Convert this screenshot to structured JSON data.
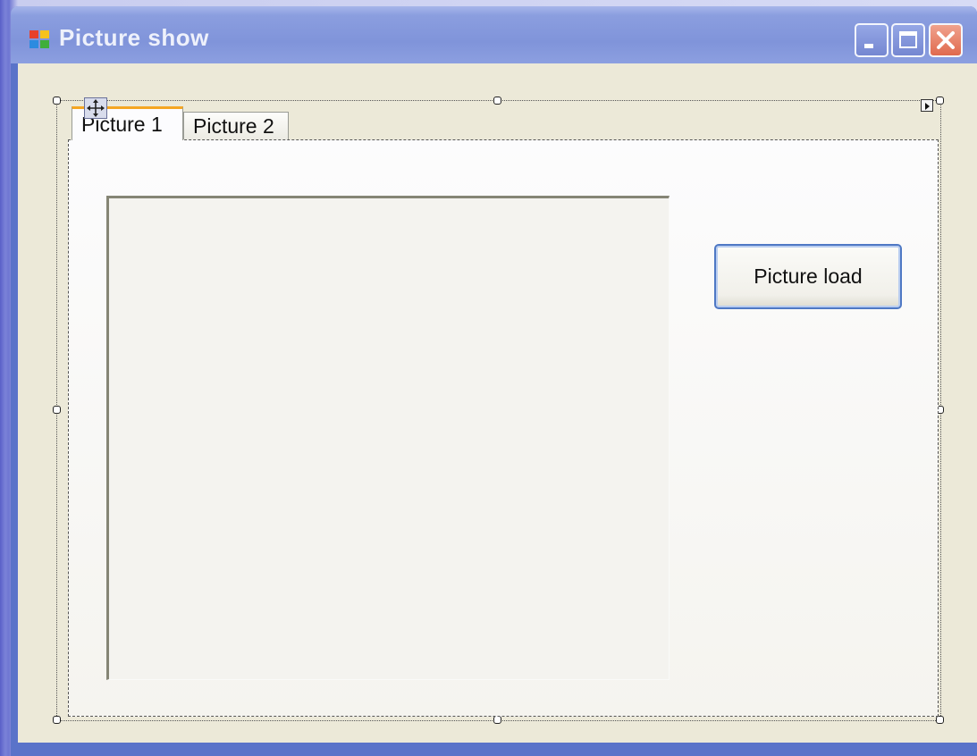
{
  "window": {
    "title": "Picture show",
    "icons": {
      "app": "form-app-icon",
      "minimize": "minimize-icon",
      "maximize": "maximize-icon",
      "close": "close-icon"
    }
  },
  "tabs": [
    {
      "label": "Picture 1",
      "selected": true
    },
    {
      "label": "Picture 2",
      "selected": false
    }
  ],
  "main": {
    "load_button_label": "Picture load"
  },
  "designer": {
    "move_handle_icon": "move-cross-icon",
    "smart_tag_icon": "smart-tag-arrow-icon"
  },
  "colors": {
    "titlebar": "#8094da",
    "client_bg": "#ece9d8",
    "close_button": "#e06a4d",
    "active_tab_accent": "#f5a623",
    "button_border": "#4e78c4"
  }
}
